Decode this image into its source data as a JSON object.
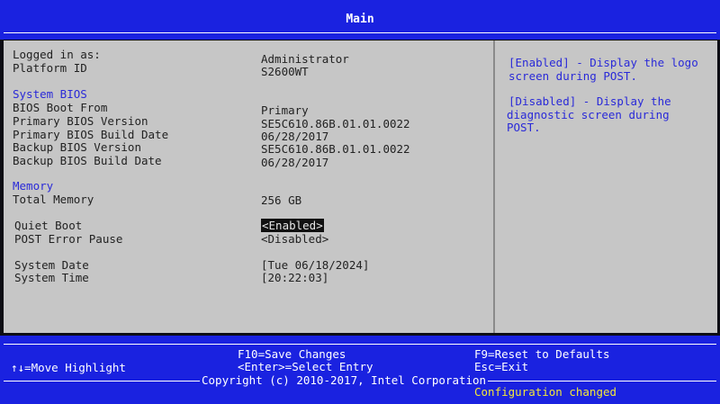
{
  "header": {
    "title": "Main"
  },
  "info": {
    "logged_in_label": "Logged in as:",
    "logged_in_value": "Administrator",
    "platform_label": "Platform ID",
    "platform_value": "S2600WT"
  },
  "system_bios": {
    "heading": "System BIOS",
    "boot_from_label": "BIOS Boot From",
    "boot_from_value": "Primary",
    "primary_version_label": "Primary BIOS Version",
    "primary_version_value": "SE5C610.86B.01.01.0022",
    "primary_date_label": "Primary BIOS Build Date",
    "primary_date_value": "06/28/2017",
    "backup_version_label": "Backup BIOS Version",
    "backup_version_value": "SE5C610.86B.01.01.0022",
    "backup_date_label": "Backup BIOS Build Date",
    "backup_date_value": "06/28/2017"
  },
  "memory": {
    "heading": "Memory",
    "total_label": "Total Memory",
    "total_value": "256 GB"
  },
  "boot_options": {
    "quiet_boot_label": "Quiet Boot",
    "quiet_boot_value": "<Enabled>",
    "post_error_label": "POST Error Pause",
    "post_error_value": "<Disabled>"
  },
  "datetime": {
    "date_label": "System Date",
    "date_value": "[Tue 06/18/2024]",
    "time_label": "System Time",
    "time_value": "[20:22:03]"
  },
  "help": {
    "line1": "[Enabled] - Display the logo",
    "line2": "screen during POST.",
    "line3": "[Disabled] - Display the",
    "line4": "diagnostic screen during",
    "line5": "POST."
  },
  "footer": {
    "move_highlight": "↑↓=Move Highlight",
    "save_changes": "F10=Save Changes",
    "select_entry": "<Enter>=Select Entry",
    "reset_defaults": "F9=Reset to Defaults",
    "exit": "Esc=Exit",
    "copyright": "Copyright (c) 2010-2017, Intel Corporation",
    "status": "Configuration changed"
  },
  "colors": {
    "bar_blue": "#1a22e0",
    "panel_gray": "#c6c6c6",
    "section_blue": "#2a2ad8",
    "status_yellow": "#f2e73a"
  }
}
